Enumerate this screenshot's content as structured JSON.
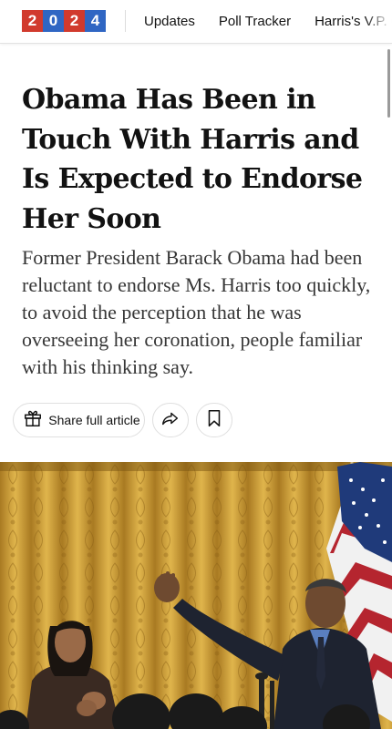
{
  "logo": {
    "digits": [
      "2",
      "0",
      "2",
      "4"
    ],
    "colors": [
      "#d13a2d",
      "#2f66c3",
      "#d13a2d",
      "#2f66c3"
    ]
  },
  "nav": {
    "links": [
      "Updates",
      "Poll Tracker",
      "Harris's V.P. C"
    ]
  },
  "article": {
    "headline": "Obama Has Been in Touch With Harris and Is Expected to Endorse Her Soon",
    "summary": "Former President Barack Obama had been reluctant to endorse Ms. Harris too quickly, to avoid the perception that he was overseeing her coronation, people familiar with his thinking say."
  },
  "actions": {
    "share_label": "Share full article"
  }
}
